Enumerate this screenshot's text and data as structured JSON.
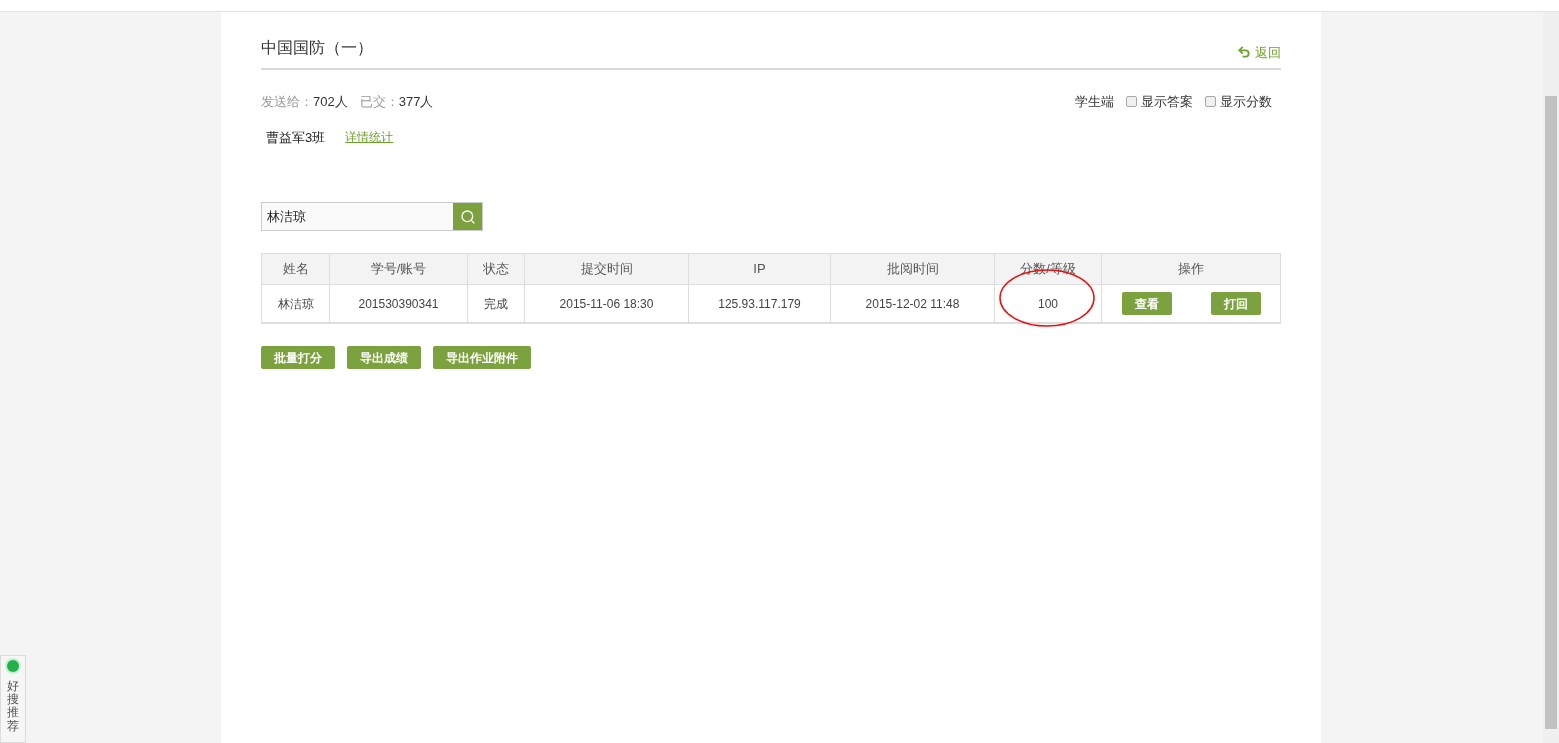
{
  "header": {
    "title": "中国国防（一）",
    "back_link": "返回"
  },
  "stats": [
    {
      "label": "发送给：",
      "value": "702人"
    },
    {
      "label": "已交：",
      "value": "377人"
    }
  ],
  "view_options": {
    "label": "学生端",
    "checkboxes": [
      {
        "label": "显示答案",
        "checked": false
      },
      {
        "label": "显示分数",
        "checked": false
      }
    ]
  },
  "class_filter": {
    "class_name": "曹益军3班",
    "link": "详情统计"
  },
  "search": {
    "value": "林洁琼"
  },
  "table": {
    "columns": [
      "姓名",
      "学号/账号",
      "状态",
      "提交时间",
      "IP",
      "批阅时间",
      "分数/等级",
      "操作"
    ],
    "rows": [
      {
        "cells": [
          "林洁琼",
          "201530390341",
          "完成",
          "2015-11-06 18:30",
          "125.93.117.179",
          "2015-12-02 11:48",
          "100"
        ],
        "actions": [
          "查看",
          "打回"
        ]
      }
    ]
  },
  "bottom_buttons": [
    "批量打分",
    "导出成绩",
    "导出作业附件"
  ],
  "side_widget": {
    "label": "好搜推荐"
  }
}
